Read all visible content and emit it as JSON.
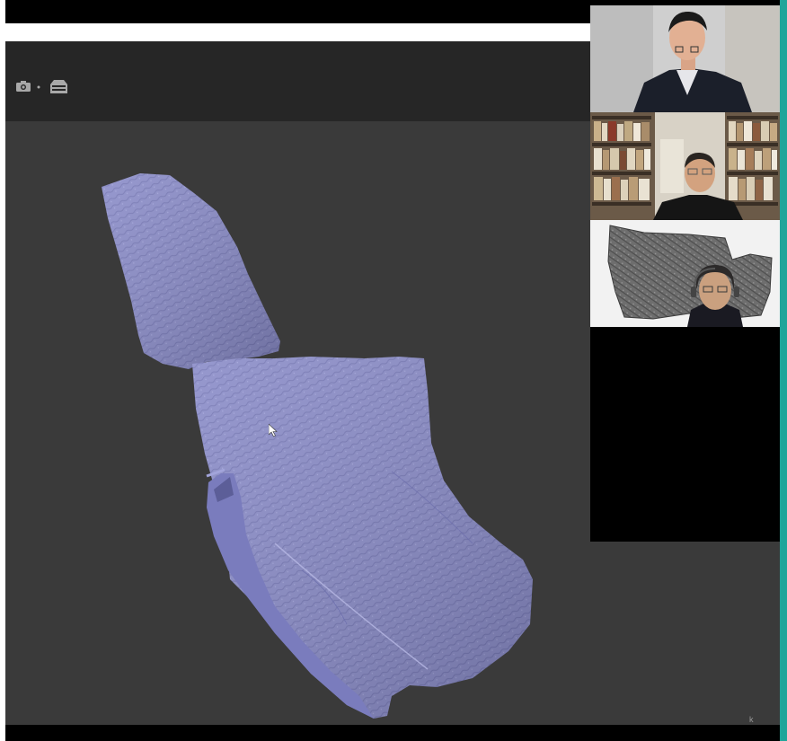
{
  "colors": {
    "frame_accent": "#1fa59a",
    "viewer_background": "#3a3a3a",
    "toolbar_background": "#262626",
    "model_color": "#8a8cc8",
    "app_background": "#000000"
  },
  "toolbar": {
    "icons": [
      "camera-icon",
      "dropdown-dot-icon",
      "layers-icon"
    ]
  },
  "viewer": {
    "object": "3d-scanned-pottery-sherd"
  },
  "participants": [
    {
      "id": "participant-1"
    },
    {
      "id": "participant-2"
    },
    {
      "id": "participant-3"
    }
  ],
  "corner_glyph": "k"
}
